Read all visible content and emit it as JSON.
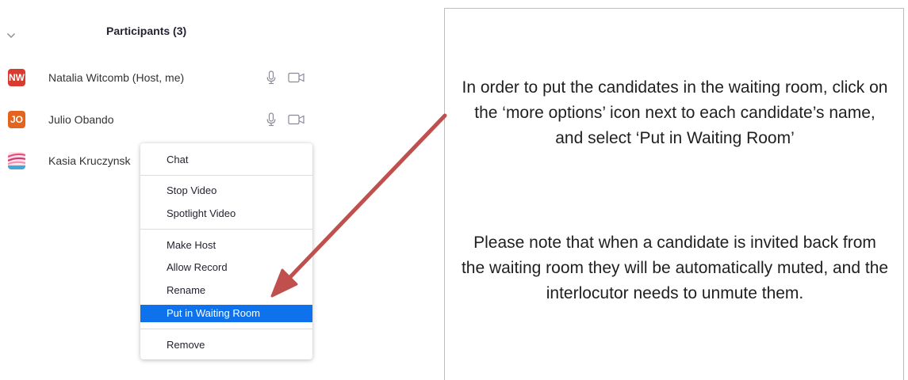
{
  "participants": {
    "title": "Participants (3)",
    "list": [
      {
        "initials": "NW",
        "name": "Natalia Witcomb (Host, me)",
        "avatar_color": "#d83b2f"
      },
      {
        "initials": "JO",
        "name": "Julio Obando",
        "avatar_color": "#e5641d"
      },
      {
        "initials": "",
        "name": "Kasia Kruczynsk",
        "avatar_color": "#e84f7a"
      }
    ]
  },
  "context_menu": {
    "items": [
      {
        "label": "Chat"
      },
      {
        "label": "Stop Video"
      },
      {
        "label": "Spotlight Video"
      },
      {
        "label": "Make Host"
      },
      {
        "label": "Allow Record"
      },
      {
        "label": "Rename"
      },
      {
        "label": "Put in Waiting Room",
        "selected": true
      },
      {
        "label": "Remove"
      }
    ]
  },
  "instructions": {
    "paragraph_1": "In order to put the candidates in the waiting room, click on the ‘more options’ icon next to each candidate’s name, and select ‘Put in Waiting Room’",
    "paragraph_2": "Please note that when a candidate is invited back from the waiting room they will be automatically muted, and the interlocutor needs to unmute them."
  },
  "colors": {
    "selection": "#0e72ed",
    "arrow": "#c0504d",
    "icon_gray": "#8a8a99"
  }
}
